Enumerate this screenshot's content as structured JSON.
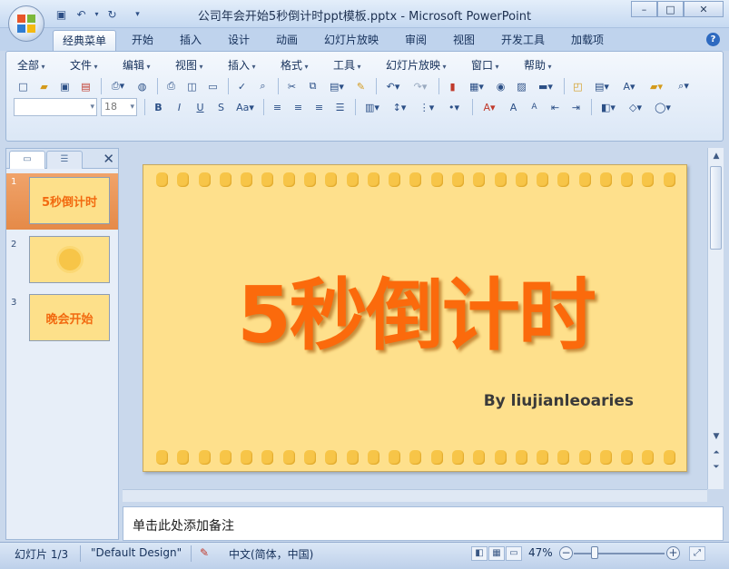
{
  "window": {
    "title": "公司年会开始5秒倒计时ppt模板.pptx - Microsoft PowerPoint",
    "minimize": "–",
    "maximize": "□",
    "close": "✕"
  },
  "tabs": [
    {
      "label": "经典菜单",
      "active": true
    },
    {
      "label": "开始"
    },
    {
      "label": "插入"
    },
    {
      "label": "设计"
    },
    {
      "label": "动画"
    },
    {
      "label": "幻灯片放映"
    },
    {
      "label": "审阅"
    },
    {
      "label": "视图"
    },
    {
      "label": "开发工具"
    },
    {
      "label": "加载项"
    }
  ],
  "help_glyph": "?",
  "menu": [
    "全部",
    "文件",
    "编辑",
    "视图",
    "插入",
    "格式",
    "工具",
    "幻灯片放映",
    "窗口",
    "帮助"
  ],
  "format_bar": {
    "font_name": "",
    "font_size": "18"
  },
  "left_pane": {
    "close_glyph": "✕",
    "slides": [
      {
        "num": "1",
        "label": "5秒倒计时"
      },
      {
        "num": "2",
        "label": ""
      },
      {
        "num": "3",
        "label": "晚会开始"
      }
    ]
  },
  "slide": {
    "title": "5秒倒计时",
    "subtitle": "By liujianleoaries"
  },
  "notes": {
    "placeholder": "单击此处添加备注"
  },
  "status": {
    "slide_info": "幻灯片 1/3",
    "theme": "\"Default Design\"",
    "language": "中文(简体，中国)",
    "zoom": "47%",
    "zoom_minus": "−",
    "zoom_plus": "+"
  },
  "colors": {
    "slide_bg": "#fee08c",
    "title": "#fb6a0c",
    "dots": "#f7c548"
  }
}
